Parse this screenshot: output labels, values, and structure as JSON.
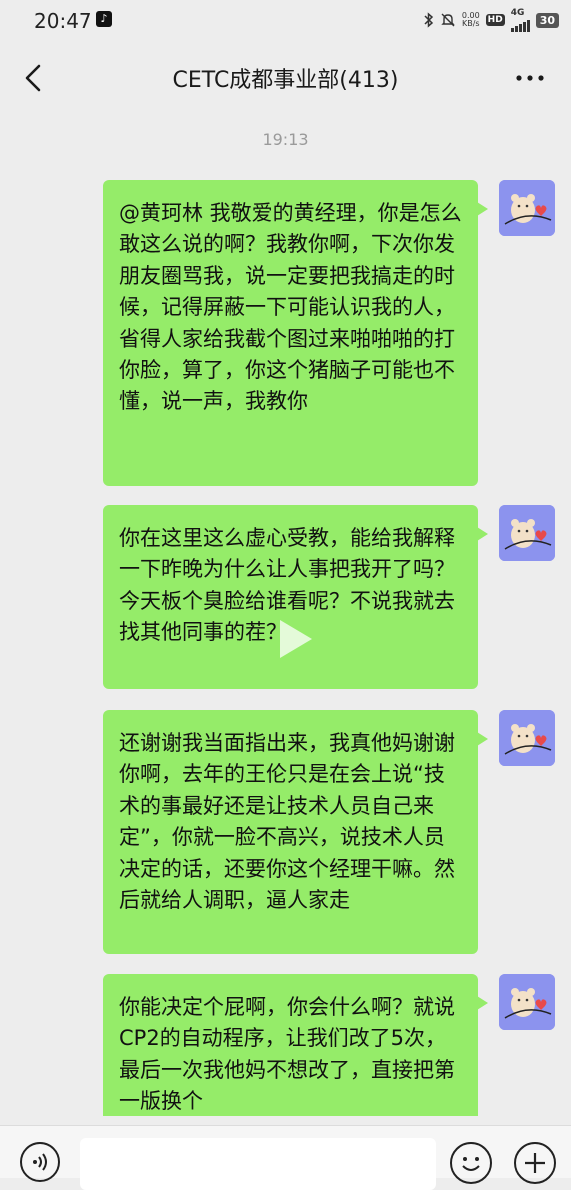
{
  "status_bar": {
    "time": "20:47",
    "net_speed_value": "0.00",
    "net_speed_unit": "KB/s",
    "hd_label": "HD",
    "network": "4G",
    "battery": "30"
  },
  "header": {
    "title": "CETC成都事业部(413)"
  },
  "chat": {
    "timestamp": "19:13",
    "messages": [
      {
        "text": "@黄珂林 我敬爱的黄经理，你是怎么敢这么说的啊？我教你啊，下次你发朋友圈骂我，说一定要把我搞走的时候，记得屏蔽一下可能认识我的人，省得人家给我截个图过来啪啪啪的打你脸，算了，你这个猪脑子可能也不懂，说一声，我教你"
      },
      {
        "text": "你在这里这么虚心受教，能给我解释一下昨晚为什么让人事把我开了吗？今天板个臭脸给谁看呢？不说我就去找其他同事的茬？"
      },
      {
        "text": "还谢谢我当面指出来，我真他妈谢谢你啊，去年的王伦只是在会上说“技术的事最好还是让技术人员自己来定”，你就一脸不高兴，说技术人员决定的话，还要你这个经理干嘛。然后就给人调职，逼人家走"
      },
      {
        "text": "你能决定个屁啊，你会什么啊？就说CP2的自动程序，让我们改了5次，最后一次我他妈不想改了，直接把第一版换个"
      }
    ]
  },
  "colors": {
    "bubble": "#95ec69",
    "background": "#ededed",
    "avatar_bg": "#8c93ee"
  }
}
